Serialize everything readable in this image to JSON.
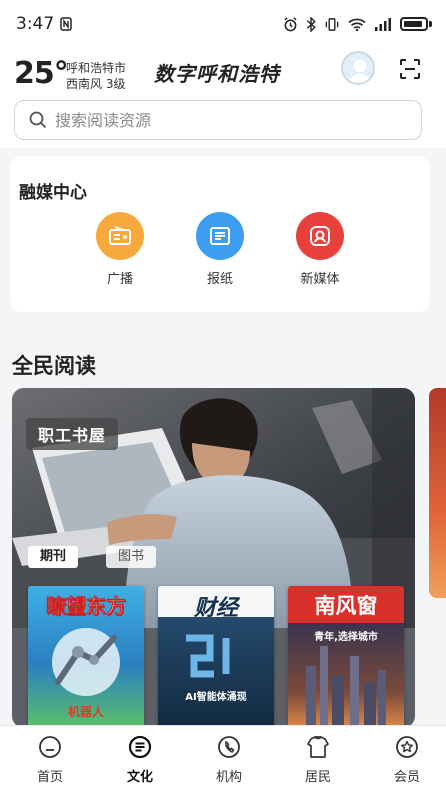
{
  "status_bar": {
    "time": "3:47",
    "notification_icon": "n-badge-icon",
    "right_icons": [
      "alarm-icon",
      "bluetooth-icon",
      "vibrate-icon",
      "wifi-icon",
      "signal-icon",
      "battery-icon"
    ]
  },
  "header": {
    "temperature": "25°",
    "city": "呼和浩特市",
    "wind": "西南风 3级",
    "slogan": "数字呼和浩特"
  },
  "search": {
    "placeholder": "搜索阅读资源"
  },
  "media_center": {
    "title": "融媒中心",
    "items": [
      {
        "label": "广播",
        "icon": "radio-icon",
        "color": "#f7a93b"
      },
      {
        "label": "报纸",
        "icon": "newspaper-icon",
        "color": "#3d9df1"
      },
      {
        "label": "新媒体",
        "icon": "new-media-icon",
        "color": "#e8403b"
      }
    ]
  },
  "reading": {
    "title": "全民阅读",
    "banner": {
      "badge": "职工书屋",
      "tabs": [
        "期刊",
        "图书"
      ],
      "active_tab": "期刊",
      "magazines": [
        {
          "title": "瞭望东方",
          "subtitle": "机器人",
          "cover_color": "#35a8de"
        },
        {
          "title": "财经",
          "subtitle": "AI智能体涌现",
          "cover_color": "#1e3d5a"
        },
        {
          "title": "南风窗",
          "subtitle": "青年,选择城市",
          "cover_color": "#d8302a"
        }
      ]
    }
  },
  "bottom_nav": {
    "active": "文化",
    "items": [
      {
        "label": "首页",
        "icon": "home-icon"
      },
      {
        "label": "文化",
        "icon": "culture-icon"
      },
      {
        "label": "机构",
        "icon": "institution-icon"
      },
      {
        "label": "居民",
        "icon": "resident-icon"
      },
      {
        "label": "会员",
        "icon": "member-icon"
      }
    ]
  }
}
